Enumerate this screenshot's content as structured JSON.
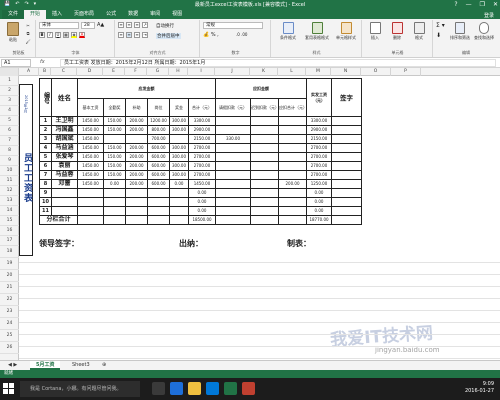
{
  "window": {
    "title": "最新员工excel工资表模板.xls [兼容模式] - Excel",
    "buttons": [
      "?",
      "—",
      "❐",
      "✕"
    ]
  },
  "qat": [
    "💾",
    "↶",
    "↷",
    "▾"
  ],
  "tabs": [
    "文件",
    "开始",
    "插入",
    "页面布局",
    "公式",
    "数据",
    "审阅",
    "视图"
  ],
  "active_tab": 1,
  "login": "登录",
  "ribbon": {
    "clipboard": {
      "label": "剪贴板",
      "paste": "粘贴"
    },
    "font": {
      "label": "字体",
      "font_name": "宋体",
      "font_size": "28",
      "bold": "B",
      "italic": "I",
      "underline": "U"
    },
    "alignment": {
      "label": "对齐方式",
      "wrap": "自动换行",
      "merge": "合并后居中"
    },
    "number": {
      "label": "数字",
      "format": "常规"
    },
    "styles": {
      "label": "样式",
      "cond": "条件格式",
      "table": "套用表格格式",
      "cell": "单元格样式"
    },
    "cells": {
      "label": "单元格",
      "insert": "插入",
      "delete": "删除",
      "format": "格式"
    },
    "editing": {
      "label": "编辑",
      "sort": "排序和筛选",
      "find": "查找和选择"
    }
  },
  "formula_bar": {
    "name_box": "A1",
    "fx": "fx",
    "content": "员工工资表    发放日期：2015年2月12日  所属日期：2015年1月"
  },
  "columns": [
    "A",
    "B",
    "C",
    "D",
    "E",
    "F",
    "G",
    "H",
    "I",
    "J",
    "K",
    "L",
    "M",
    "N",
    "O",
    "P"
  ],
  "rows": [
    "1",
    "2",
    "3",
    "4",
    "5",
    "6",
    "7",
    "8",
    "9",
    "10",
    "11",
    "12",
    "13",
    "14",
    "15",
    "16",
    "17",
    "18",
    "19",
    "20",
    "21",
    "22",
    "23",
    "24",
    "25",
    "26"
  ],
  "sheet": {
    "side_title": "员工工资表",
    "side_sub": "2015年1月",
    "headers": {
      "no": "编号",
      "name": "姓名",
      "should": "应发金额",
      "deduct": "应扣金额",
      "actual": "实发工资（元）",
      "sign": "签字"
    },
    "sub_headers": [
      "基本工资",
      "全勤奖",
      "补助",
      "岗位",
      "奖金",
      "合计（元）",
      "请假扣款（元）",
      "迟到扣款（元）",
      "应扣合计（元）"
    ],
    "employees": [
      {
        "no": "1",
        "name": "王卫明",
        "base": "1450.00",
        "attend": "150.00",
        "allow": "200.00",
        "post": "1200.00",
        "bonus": "300.00",
        "total": "3300.00",
        "leave": "",
        "late": "",
        "ded": "",
        "actual": "3300.00"
      },
      {
        "no": "2",
        "name": "冯国鑫",
        "base": "1450.00",
        "attend": "150.00",
        "allow": "200.00",
        "post": "800.00",
        "bonus": "300.00",
        "total": "2900.00",
        "leave": "",
        "late": "",
        "ded": "",
        "actual": "2900.00"
      },
      {
        "no": "3",
        "name": "胡国斌",
        "base": "1450.00",
        "attend": "",
        "allow": "",
        "post": "700.00",
        "bonus": "",
        "total": "2150.00",
        "leave": "330.00",
        "late": "",
        "ded": "",
        "actual": "2150.00"
      },
      {
        "no": "4",
        "name": "马益涵",
        "base": "1450.00",
        "attend": "150.00",
        "allow": "200.00",
        "post": "600.00",
        "bonus": "300.00",
        "total": "2700.00",
        "leave": "",
        "late": "",
        "ded": "",
        "actual": "2700.00"
      },
      {
        "no": "5",
        "name": "张爱琴",
        "base": "1450.00",
        "attend": "150.00",
        "allow": "200.00",
        "post": "600.00",
        "bonus": "300.00",
        "total": "2700.00",
        "leave": "",
        "late": "",
        "ded": "",
        "actual": "2700.00"
      },
      {
        "no": "6",
        "name": "袁丽",
        "base": "1450.00",
        "attend": "150.00",
        "allow": "200.00",
        "post": "600.00",
        "bonus": "300.00",
        "total": "2700.00",
        "leave": "",
        "late": "",
        "ded": "",
        "actual": "2700.00"
      },
      {
        "no": "7",
        "name": "马益蓉",
        "base": "1450.00",
        "attend": "150.00",
        "allow": "200.00",
        "post": "600.00",
        "bonus": "300.00",
        "total": "2700.00",
        "leave": "",
        "late": "",
        "ded": "",
        "actual": "2700.00"
      },
      {
        "no": "8",
        "name": "邓蕾",
        "base": "1450.00",
        "attend": "0.00",
        "allow": "200.00",
        "post": "600.00",
        "bonus": "0.00",
        "total": "1450.00",
        "leave": "",
        "late": "",
        "ded": "200.00",
        "actual": "1250.00"
      },
      {
        "no": "9",
        "name": "",
        "base": "",
        "attend": "",
        "allow": "",
        "post": "",
        "bonus": "",
        "total": "0.00",
        "leave": "",
        "late": "",
        "ded": "",
        "actual": "0.00"
      },
      {
        "no": "10",
        "name": "",
        "base": "",
        "attend": "",
        "allow": "",
        "post": "",
        "bonus": "",
        "total": "0.00",
        "leave": "",
        "late": "",
        "ded": "",
        "actual": "0.00"
      },
      {
        "no": "11",
        "name": "",
        "base": "",
        "attend": "",
        "allow": "",
        "post": "",
        "bonus": "",
        "total": "0.00",
        "leave": "",
        "late": "",
        "ded": "",
        "actual": "0.00"
      }
    ],
    "subtotal": {
      "label": "分栏合计",
      "total": "18500.00",
      "actual": "18770.00"
    },
    "footer": {
      "leader": "领导签字：",
      "cashier": "出纳：",
      "maker": "制表："
    }
  },
  "sheet_tabs": [
    "5月工资",
    "Sheet3",
    "⊕"
  ],
  "status": "就绪",
  "taskbar": {
    "search": "我是 Cortana，小娜。有问题尽管问我。",
    "time": "9:09",
    "date": "2016-01-27"
  },
  "watermark": {
    "text": "我爱IT技术网",
    "url": "jingyan.baidu.com"
  },
  "colors": {
    "excel_green": "#217346",
    "title_blue": "#1a3c8c"
  }
}
